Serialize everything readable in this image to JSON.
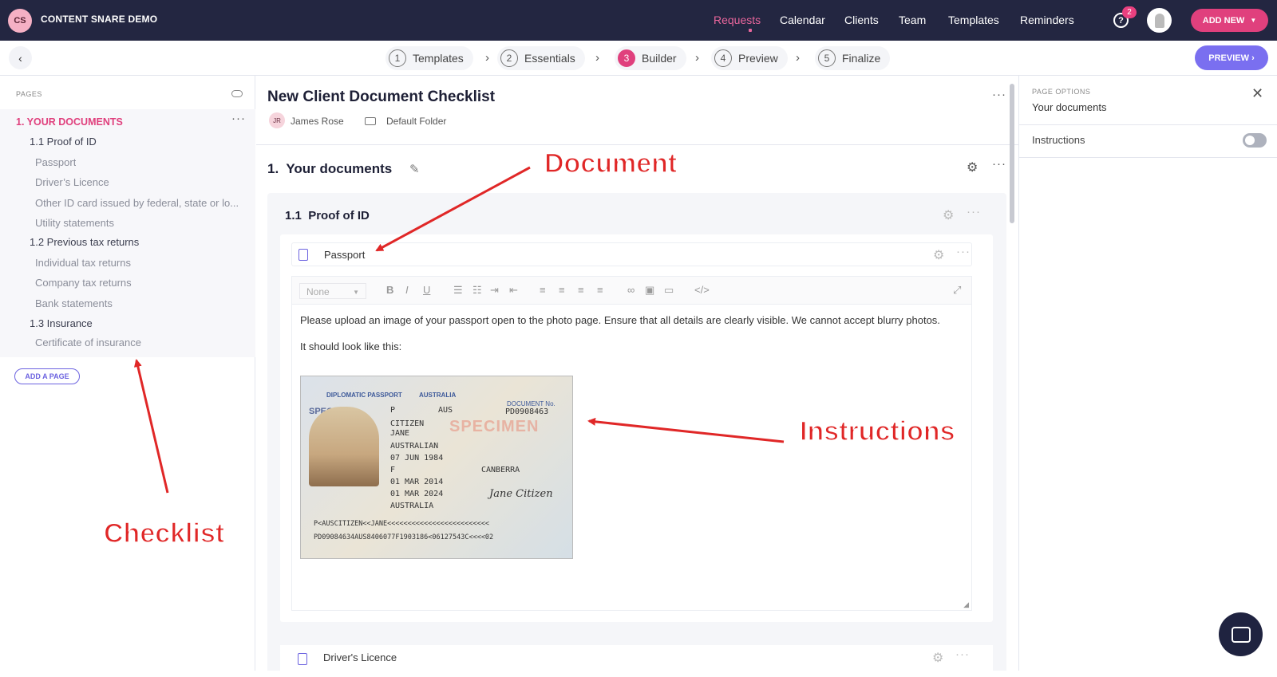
{
  "app": {
    "logo": "CS",
    "name": "CONTENT SNARE DEMO"
  },
  "nav": {
    "items": [
      "Requests",
      "Calendar",
      "Clients",
      "Team",
      "Templates",
      "Reminders"
    ],
    "active": "Requests",
    "help_badge": "2",
    "help_icon": "?",
    "add_new": "ADD NEW"
  },
  "steps": [
    {
      "num": "1",
      "label": "Templates"
    },
    {
      "num": "2",
      "label": "Essentials"
    },
    {
      "num": "3",
      "label": "Builder"
    },
    {
      "num": "4",
      "label": "Preview"
    },
    {
      "num": "5",
      "label": "Finalize"
    }
  ],
  "preview_button": "PREVIEW",
  "sidebar": {
    "heading": "PAGES",
    "items": [
      {
        "label": "1. YOUR DOCUMENTS",
        "level": 1
      },
      {
        "label": "1.1 Proof of ID",
        "level": 2
      },
      {
        "label": "Passport",
        "level": 3
      },
      {
        "label": "Driver’s Licence",
        "level": 3
      },
      {
        "label": "Other ID card issued by federal, state or lo...",
        "level": 3
      },
      {
        "label": "Utility statements",
        "level": 3
      },
      {
        "label": "1.2 Previous tax returns",
        "level": 2
      },
      {
        "label": "Individual tax returns",
        "level": 3
      },
      {
        "label": "Company tax returns",
        "level": 3
      },
      {
        "label": "Bank statements",
        "level": 3
      },
      {
        "label": "1.3 Insurance",
        "level": 2
      },
      {
        "label": "Certificate of insurance",
        "level": 3
      }
    ],
    "add_page": "ADD A PAGE"
  },
  "document": {
    "title": "New Client Document Checklist",
    "author_initials": "JR",
    "author": "James Rose",
    "folder": "Default Folder",
    "section_num": "1.",
    "section_title": "Your documents",
    "subsection_num": "1.1",
    "subsection_title": "Proof of ID",
    "item_name": "Passport",
    "format_select": "None",
    "instruction_1": "Please upload an image of your passport open to the photo page. Ensure that all details are clearly visible. We cannot accept blurry photos.",
    "instruction_2": "It should look like this:",
    "next_item": "Driver's Licence"
  },
  "passport_image": {
    "header_left": "DIPLOMATIC PASSPORT",
    "header_specimen": "SPECIMEN",
    "country": "AUSTRALIA",
    "doc_label": "DOCUMENT No.",
    "doc_number": "PD0908463",
    "type": "P",
    "code": "AUS",
    "surname": "CITIZEN",
    "given": "JANE",
    "nationality": "AUSTRALIAN",
    "dob": "07 JUN 1984",
    "sex": "F",
    "place": "CANBERRA",
    "issue": "01 MAR 2014",
    "expiry": "01 MAR 2024",
    "authority": "AUSTRALIA",
    "watermark": "SPECIMEN",
    "signature": "Jane Citizen",
    "mrz1": "P<AUSCITIZEN<<JANE<<<<<<<<<<<<<<<<<<<<<<<<<",
    "mrz2": "PD09084634AUS8406077F1903186<06127543C<<<<02"
  },
  "page_options": {
    "heading": "PAGE OPTIONS",
    "title": "Your documents",
    "instructions_label": "Instructions",
    "instructions_on": false
  },
  "annotations": {
    "document": "Document",
    "instructions": "Instructions",
    "checklist": "Checklist"
  },
  "colors": {
    "accent": "#e0407d",
    "primary": "#7a6ff0",
    "topbar": "#232641",
    "annotation": "#e02727"
  }
}
